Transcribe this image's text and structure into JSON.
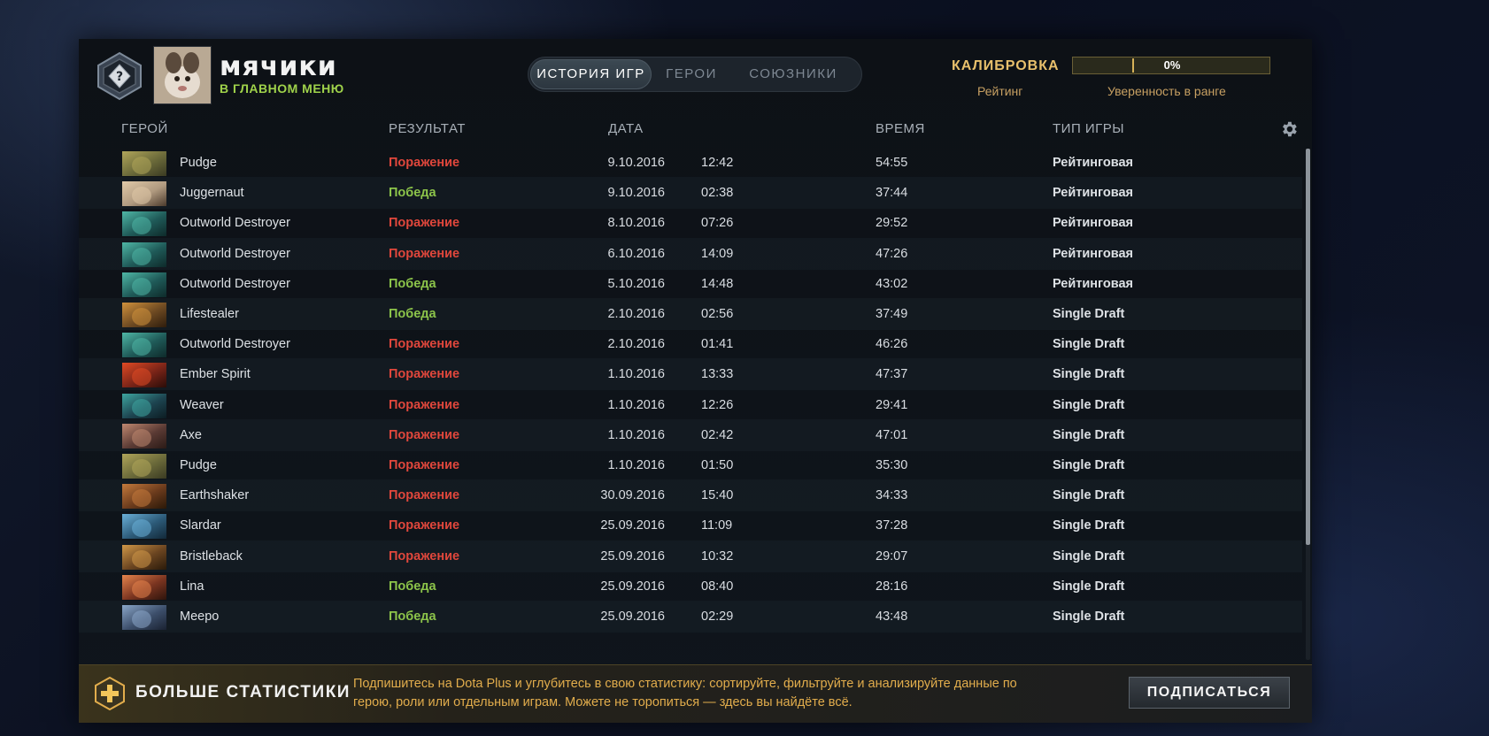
{
  "header": {
    "player_name": "мячики",
    "player_status": "В ГЛАВНОМ МЕНЮ",
    "tabs": [
      {
        "label": "ИСТОРИЯ ИГР",
        "active": true
      },
      {
        "label": "ГЕРОИ",
        "active": false
      },
      {
        "label": "СОЮЗНИКИ",
        "active": false
      }
    ],
    "calibration_label": "КАЛИБРОВКА",
    "rating_label": "Рейтинг",
    "confidence_value": "0%",
    "confidence_fraction": 0,
    "confidence_label": "Уверенность в ранге"
  },
  "columns": {
    "hero": "ГЕРОЙ",
    "result": "РЕЗУЛЬТАТ",
    "date": "ДАТА",
    "duration": "ВРЕМЯ",
    "mode": "ТИП ИГРЫ"
  },
  "matches": [
    {
      "hero": "Pudge",
      "result": "Поражение",
      "win": false,
      "date": "9.10.2016",
      "time": "12:42",
      "duration": "54:55",
      "mode": "Рейтинговая"
    },
    {
      "hero": "Juggernaut",
      "result": "Победа",
      "win": true,
      "date": "9.10.2016",
      "time": "02:38",
      "duration": "37:44",
      "mode": "Рейтинговая"
    },
    {
      "hero": "Outworld Destroyer",
      "result": "Поражение",
      "win": false,
      "date": "8.10.2016",
      "time": "07:26",
      "duration": "29:52",
      "mode": "Рейтинговая"
    },
    {
      "hero": "Outworld Destroyer",
      "result": "Поражение",
      "win": false,
      "date": "6.10.2016",
      "time": "14:09",
      "duration": "47:26",
      "mode": "Рейтинговая"
    },
    {
      "hero": "Outworld Destroyer",
      "result": "Победа",
      "win": true,
      "date": "5.10.2016",
      "time": "14:48",
      "duration": "43:02",
      "mode": "Рейтинговая"
    },
    {
      "hero": "Lifestealer",
      "result": "Победа",
      "win": true,
      "date": "2.10.2016",
      "time": "02:56",
      "duration": "37:49",
      "mode": "Single Draft"
    },
    {
      "hero": "Outworld Destroyer",
      "result": "Поражение",
      "win": false,
      "date": "2.10.2016",
      "time": "01:41",
      "duration": "46:26",
      "mode": "Single Draft"
    },
    {
      "hero": "Ember Spirit",
      "result": "Поражение",
      "win": false,
      "date": "1.10.2016",
      "time": "13:33",
      "duration": "47:37",
      "mode": "Single Draft"
    },
    {
      "hero": "Weaver",
      "result": "Поражение",
      "win": false,
      "date": "1.10.2016",
      "time": "12:26",
      "duration": "29:41",
      "mode": "Single Draft"
    },
    {
      "hero": "Axe",
      "result": "Поражение",
      "win": false,
      "date": "1.10.2016",
      "time": "02:42",
      "duration": "47:01",
      "mode": "Single Draft"
    },
    {
      "hero": "Pudge",
      "result": "Поражение",
      "win": false,
      "date": "1.10.2016",
      "time": "01:50",
      "duration": "35:30",
      "mode": "Single Draft"
    },
    {
      "hero": "Earthshaker",
      "result": "Поражение",
      "win": false,
      "date": "30.09.2016",
      "time": "15:40",
      "duration": "34:33",
      "mode": "Single Draft"
    },
    {
      "hero": "Slardar",
      "result": "Поражение",
      "win": false,
      "date": "25.09.2016",
      "time": "11:09",
      "duration": "37:28",
      "mode": "Single Draft"
    },
    {
      "hero": "Bristleback",
      "result": "Поражение",
      "win": false,
      "date": "25.09.2016",
      "time": "10:32",
      "duration": "29:07",
      "mode": "Single Draft"
    },
    {
      "hero": "Lina",
      "result": "Победа",
      "win": true,
      "date": "25.09.2016",
      "time": "08:40",
      "duration": "28:16",
      "mode": "Single Draft"
    },
    {
      "hero": "Meepo",
      "result": "Победа",
      "win": true,
      "date": "25.09.2016",
      "time": "02:29",
      "duration": "43:48",
      "mode": "Single Draft"
    }
  ],
  "footer": {
    "title": "БОЛЬШЕ СТАТИСТИКИ",
    "description": "Подпишитесь на Dota Plus и углубитесь в свою статистику: сортируйте, фильтруйте и анализируйте данные по герою, роли или отдельным играм. Можете не торопиться — здесь вы найдёте всё.",
    "button": "ПОДПИСАТЬСЯ"
  },
  "colors": {
    "loss": "#e0473c",
    "win": "#8cc44a",
    "accent_gold": "#e8c06c",
    "status_green": "#9fd24a"
  }
}
